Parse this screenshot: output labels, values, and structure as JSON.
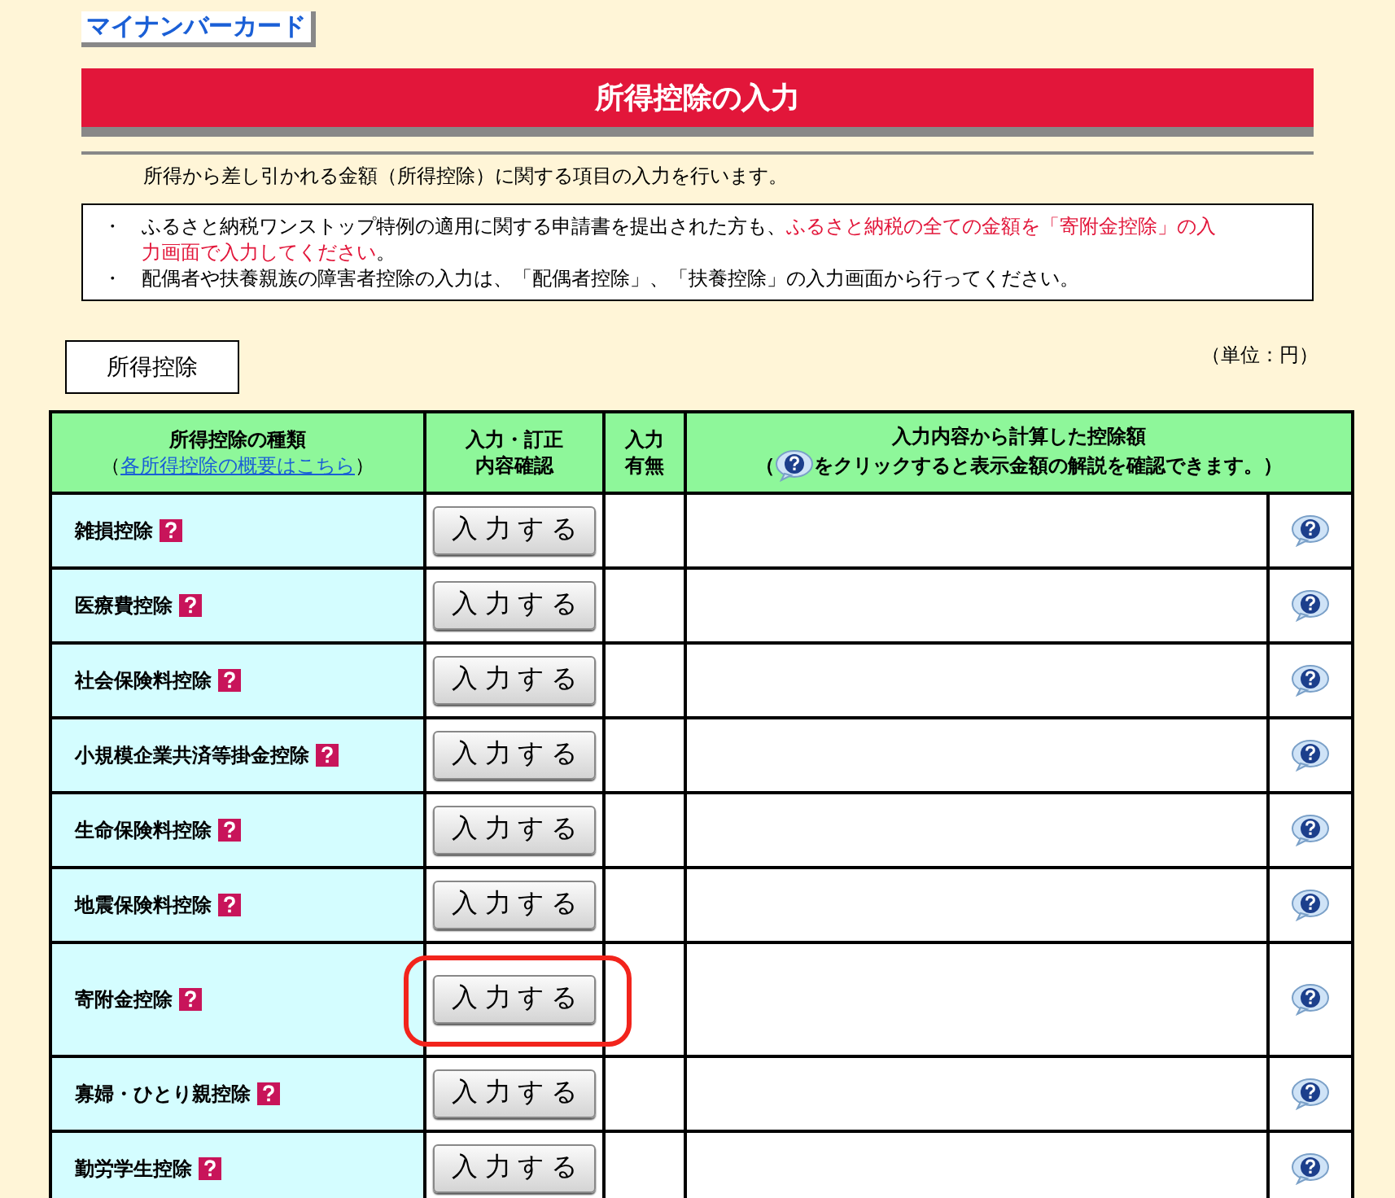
{
  "top_link": "マイナンバーカード",
  "title": "所得控除の入力",
  "intro": "所得から差し引かれる金額（所得控除）に関する項目の入力を行います。",
  "notices": [
    {
      "text": "ふるさと納税ワンストップ特例の適用に関する申請書を提出された方も、",
      "emphasis": "ふるさと納税の全ての金額を「寄附金控除」の入力画面で入力してください",
      "tail": "。"
    },
    {
      "text": "配偶者や扶養親族の障害者控除の入力は、「配偶者控除」、「扶養控除」の入力画面から行ってください。"
    }
  ],
  "bullet": "・",
  "section_label": "所得控除",
  "unit": "（単位：円）",
  "columns": {
    "type": {
      "title": "所得控除の種類",
      "open": "（",
      "link": "各所得控除の概要はこちら",
      "close": "）"
    },
    "input": [
      "入力・訂正",
      "内容確認"
    ],
    "status": [
      "入力",
      "有無"
    ],
    "amount": {
      "title": "入力内容から計算した控除額",
      "before": "（",
      "after": "をクリックすると表示金額の解説を確認できます。）"
    }
  },
  "rows": [
    {
      "name": "雑損控除",
      "button": "入 力 す る",
      "highlighted": false
    },
    {
      "name": "医療費控除",
      "button": "入 力 す る",
      "highlighted": false
    },
    {
      "name": "社会保険料控除",
      "button": "入 力 す る",
      "highlighted": false
    },
    {
      "name": "小規模企業共済等掛金控除",
      "button": "入 力 す る",
      "highlighted": false
    },
    {
      "name": "生命保険料控除",
      "button": "入 力 す る",
      "highlighted": false
    },
    {
      "name": "地震保険料控除",
      "button": "入 力 す る",
      "highlighted": false
    },
    {
      "name": "寄附金控除",
      "button": "入 力 す る",
      "highlighted": true
    },
    {
      "name": "寡婦・ひとり親控除",
      "button": "入 力 す る",
      "highlighted": false
    },
    {
      "name": "勤労学生控除",
      "button": "入 力 す る",
      "highlighted": false
    }
  ]
}
